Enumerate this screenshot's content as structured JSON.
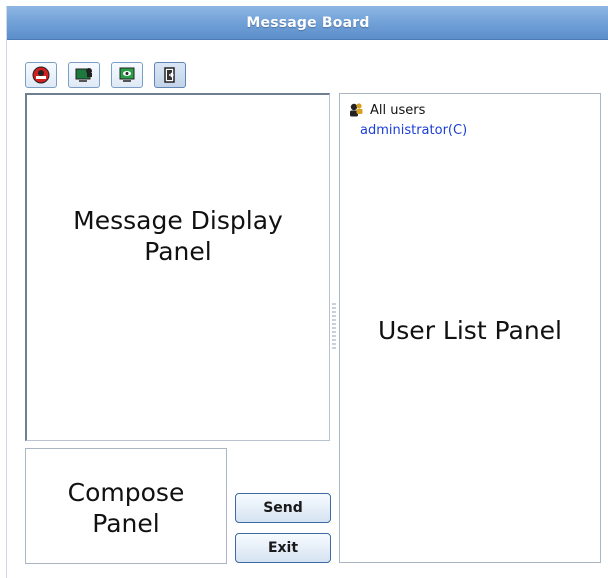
{
  "window": {
    "title": "Message Board"
  },
  "toolbar": {
    "buttons": [
      {
        "icon": "red-stop-icon",
        "active": false
      },
      {
        "icon": "monitor-user-icon",
        "active": false
      },
      {
        "icon": "monitor-eye-icon",
        "active": false
      },
      {
        "icon": "exit-door-icon",
        "active": true
      }
    ]
  },
  "panels": {
    "display_label_line1": "Message Display",
    "display_label_line2": "Panel",
    "compose_label_line1": "Compose",
    "compose_label_line2": "Panel",
    "userlist_label": "User List Panel"
  },
  "users": {
    "group_label": "All users",
    "items": [
      {
        "name": "administrator(C)"
      }
    ]
  },
  "actions": {
    "send_label": "Send",
    "exit_label": "Exit"
  },
  "colors": {
    "titlebar": "#6f9fd6",
    "user_link": "#1c3fd6"
  }
}
